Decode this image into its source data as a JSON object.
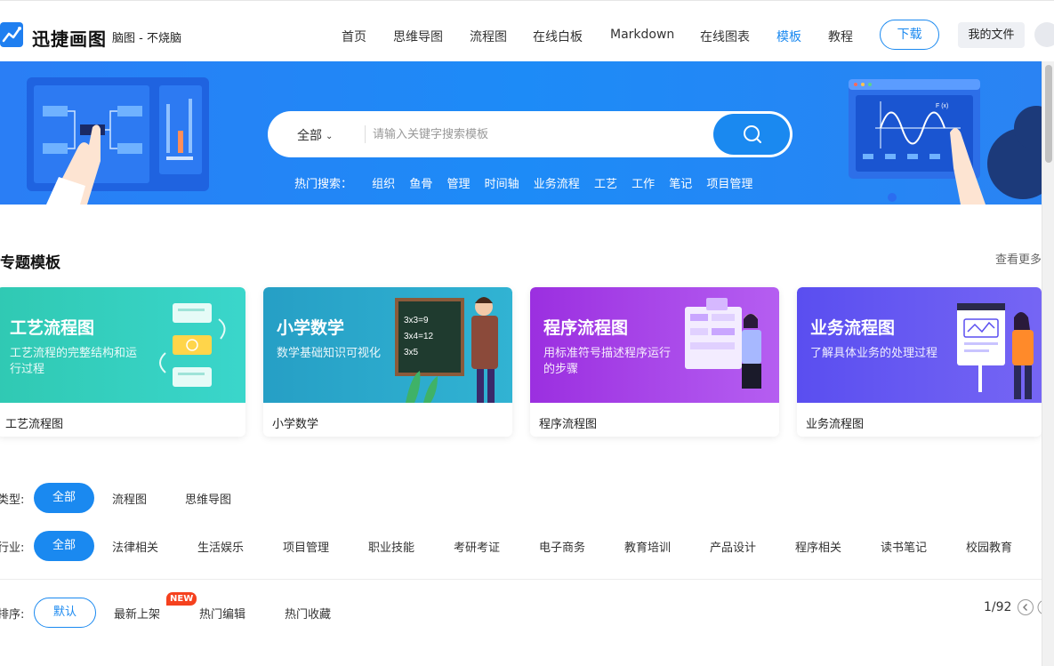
{
  "brand": {
    "name": "迅捷画图",
    "slogan": "脑图 - 不烧脑"
  },
  "nav": {
    "items": [
      {
        "label": "首页"
      },
      {
        "label": "思维导图"
      },
      {
        "label": "流程图"
      },
      {
        "label": "在线白板"
      },
      {
        "label": "Markdown"
      },
      {
        "label": "在线图表"
      },
      {
        "label": "模板",
        "active": true
      },
      {
        "label": "教程"
      }
    ],
    "download_label": "下载",
    "myfiles_label": "我的文件",
    "active_color": "#1a89f0"
  },
  "search": {
    "category": "全部",
    "placeholder": "请输入关键字搜索模板",
    "hot_label": "热门搜索：",
    "hot_terms": [
      "组织",
      "鱼骨",
      "管理",
      "时间轴",
      "业务流程",
      "工艺",
      "工作",
      "笔记",
      "项目管理"
    ]
  },
  "topics": {
    "title": "专题模板",
    "see_more": "查看更多",
    "cards": [
      {
        "title": "工艺流程图",
        "desc": "工艺流程的完整结构和运行过程",
        "caption": "工艺流程图",
        "color_from": "#2fd2b8",
        "color_to": "#34d5c6"
      },
      {
        "title": "小学数学",
        "desc": "数学基础知识可视化",
        "caption": "小学数学",
        "color_from": "#29a6c9",
        "color_to": "#2eb4d2"
      },
      {
        "title": "程序流程图",
        "desc": "用标准符号描述程序运行的步骤",
        "caption": "程序流程图",
        "color_from": "#9a2ee0",
        "color_to": "#b45cf0"
      },
      {
        "title": "业务流程图",
        "desc": "了解具体业务的处理过程",
        "caption": "业务流程图",
        "color_from": "#5b4ef0",
        "color_to": "#7a6cf5"
      }
    ]
  },
  "filters": {
    "type_label": "类型:",
    "type_options": [
      "全部",
      "流程图",
      "思维导图"
    ],
    "industry_label": "行业:",
    "industry_options": [
      "全部",
      "法律相关",
      "生活娱乐",
      "项目管理",
      "职业技能",
      "考研考证",
      "电子商务",
      "教育培训",
      "产品设计",
      "程序相关",
      "读书笔记",
      "校园教育"
    ],
    "sort_label": "排序:",
    "sort_options": [
      "默认",
      "最新上架",
      "热门编辑",
      "热门收藏"
    ],
    "new_badge": "NEW"
  },
  "pagination": {
    "text": "1/92"
  }
}
